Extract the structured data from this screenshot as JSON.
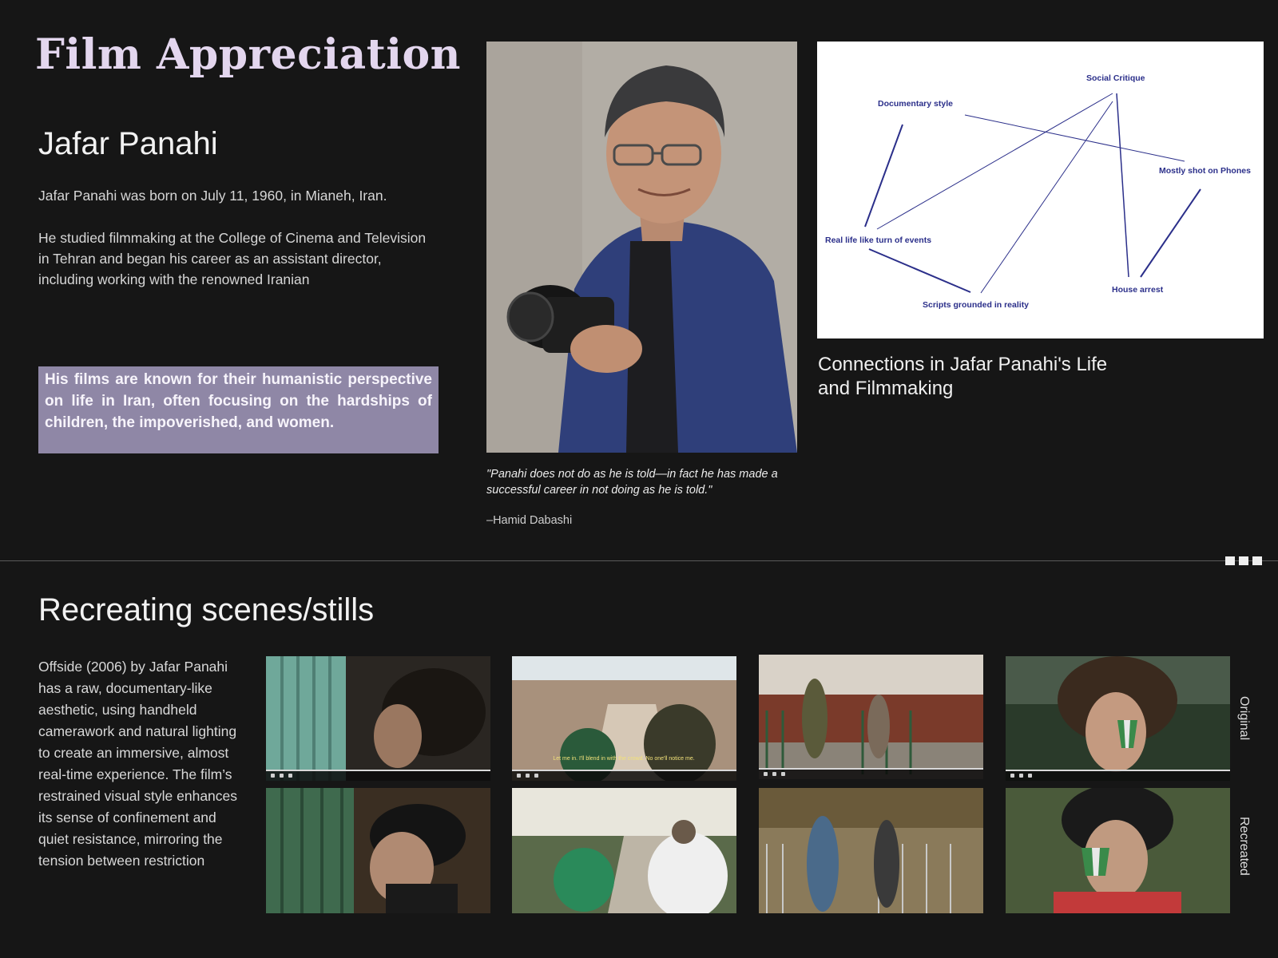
{
  "header": {
    "title": "Film Appreciation"
  },
  "subject": {
    "name": "Jafar Panahi",
    "bio_birth": "Jafar Panahi was born on July 11, 1960, in Mianeh, Iran.",
    "bio_study": "He studied filmmaking at the College of Cinema and Television",
    "bio_career": "in Tehran and began his career as an assistant director, including working with the renowned Iranian",
    "highlight": "His films are known for their humanistic perspective on life in Iran, often focusing on the hardships of children, the impoverished, and women."
  },
  "quote": {
    "text": "\"Panahi does not do as he is told—in fact he has made a successful career in not doing as he is told.\"",
    "author": "–Hamid Dabashi"
  },
  "diagram": {
    "nodes": {
      "social_critique": "Social Critique",
      "documentary_style": "Documentary style",
      "mostly_shot_on_phones": "Mostly shot on Phones",
      "real_life": "Real life like turn of events",
      "house_arrest": "House arrest",
      "scripts_grounded": "Scripts grounded in reality"
    },
    "caption": "Connections in Jafar Panahi's Life and Filmmaking",
    "line_color": "#2b2f8a"
  },
  "section": {
    "title": "Recreating scenes/stills",
    "body": "Offside (2006) by Jafar Panahi has a raw, documentary-like aesthetic, using handheld camerawork and natural lighting to create an immersive, almost real-time experience. The film’s restrained visual style enhances its sense of confinement and quiet resistance, mirroring the tension between restriction",
    "label_original": "Original",
    "label_recreated": "Recreated",
    "subtitle_still2": "Let me in. I'll blend in with the crowd. No one'll notice me."
  },
  "colors": {
    "background": "#161616",
    "title": "#e3d6ee",
    "highlight_box": "#8f87a6"
  }
}
